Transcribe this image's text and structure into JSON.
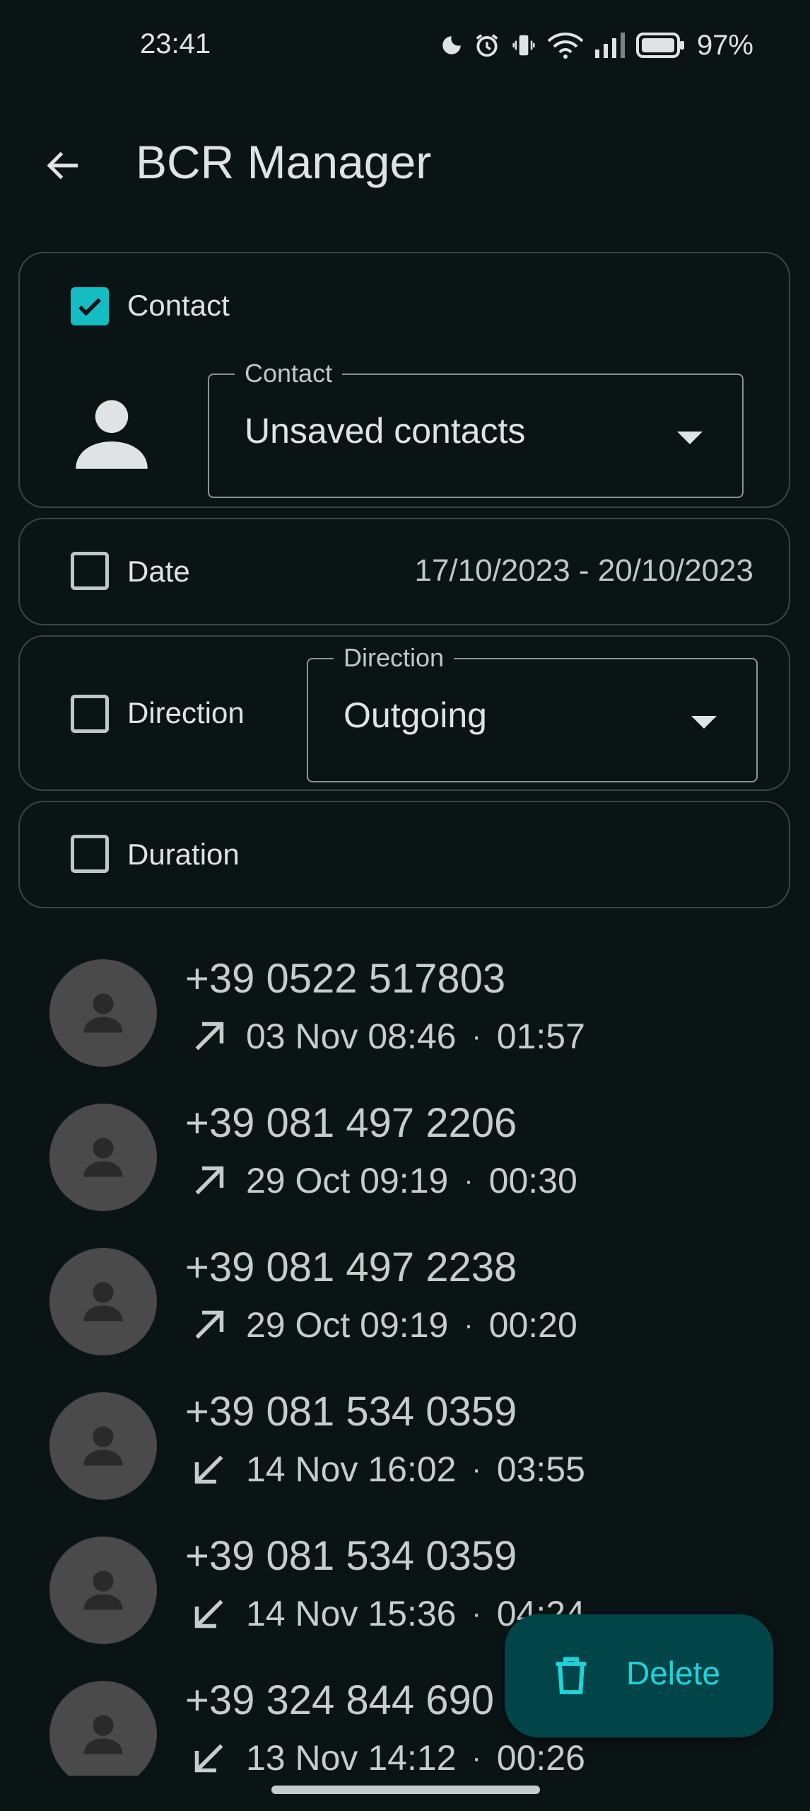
{
  "status_bar": {
    "time": "23:41",
    "battery_percent": "97%",
    "icons": [
      "moon-icon",
      "alarm-icon",
      "vibrate-icon",
      "wifi-icon",
      "signal-icon",
      "battery-icon"
    ]
  },
  "app_bar": {
    "back_icon": "arrow-back-icon",
    "title": "BCR Manager"
  },
  "filters": {
    "contact": {
      "checked": true,
      "label": "Contact",
      "field_label": "Contact",
      "field_value": "Unsaved contacts"
    },
    "date": {
      "checked": false,
      "label": "Date",
      "range": "17/10/2023 - 20/10/2023"
    },
    "direction": {
      "checked": false,
      "label": "Direction",
      "field_label": "Direction",
      "field_value": "Outgoing"
    },
    "duration": {
      "checked": false,
      "label": "Duration"
    }
  },
  "calls": [
    {
      "number": "+39 0522 517803",
      "direction": "outgoing",
      "datetime": "03 Nov 08:46",
      "duration": "01:57"
    },
    {
      "number": "+39 081 497 2206",
      "direction": "outgoing",
      "datetime": "29 Oct 09:19",
      "duration": "00:30"
    },
    {
      "number": "+39 081 497 2238",
      "direction": "outgoing",
      "datetime": "29 Oct 09:19",
      "duration": "00:20"
    },
    {
      "number": "+39 081 534 0359",
      "direction": "incoming",
      "datetime": "14 Nov 16:02",
      "duration": "03:55"
    },
    {
      "number": "+39 081 534 0359",
      "direction": "incoming",
      "datetime": "14 Nov 15:36",
      "duration": "04:24"
    },
    {
      "number": "+39 324 844 690",
      "direction": "incoming",
      "datetime": "13 Nov 14:12",
      "duration": "00:26"
    }
  ],
  "separator": "·",
  "fab": {
    "icon": "trash-icon",
    "label": "Delete"
  },
  "colors": {
    "background": "#0b1415",
    "accent": "#14bdc4",
    "fab_background": "#014548",
    "fab_text": "#1fd3dc",
    "avatar": "#4a4a4a"
  }
}
